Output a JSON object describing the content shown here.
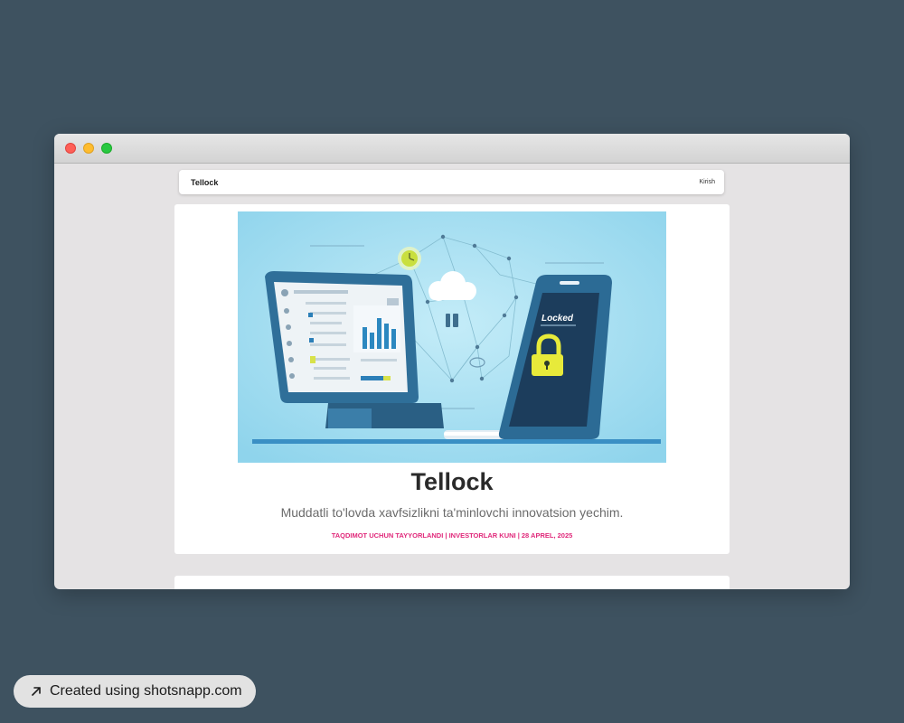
{
  "navbar": {
    "brand": "Tellock",
    "login_label": "Kirish"
  },
  "hero": {
    "title": "Tellock",
    "subtitle": "Muddatli to'lovda xavfsizlikni ta'minlovchi innovatsion yechim.",
    "meta": "TAQDIMOT UCHUN TAYYORLANDI | INVESTORLAR KUNI | 28 APREL, 2025",
    "illustration": {
      "phone_screen_label": "Locked",
      "icons": [
        "laptop-dashboard",
        "smartphone",
        "padlock-icon",
        "cloud-icon",
        "clock-icon"
      ]
    }
  },
  "badge": {
    "label": "Created using shotsnapp.com",
    "icon": "arrow-up-right-icon"
  },
  "colors": {
    "background": "#3e5260",
    "accent_pink": "#e0287a",
    "illustration_sky": "#a5dff0",
    "window_chrome": "#e5e3e4"
  }
}
